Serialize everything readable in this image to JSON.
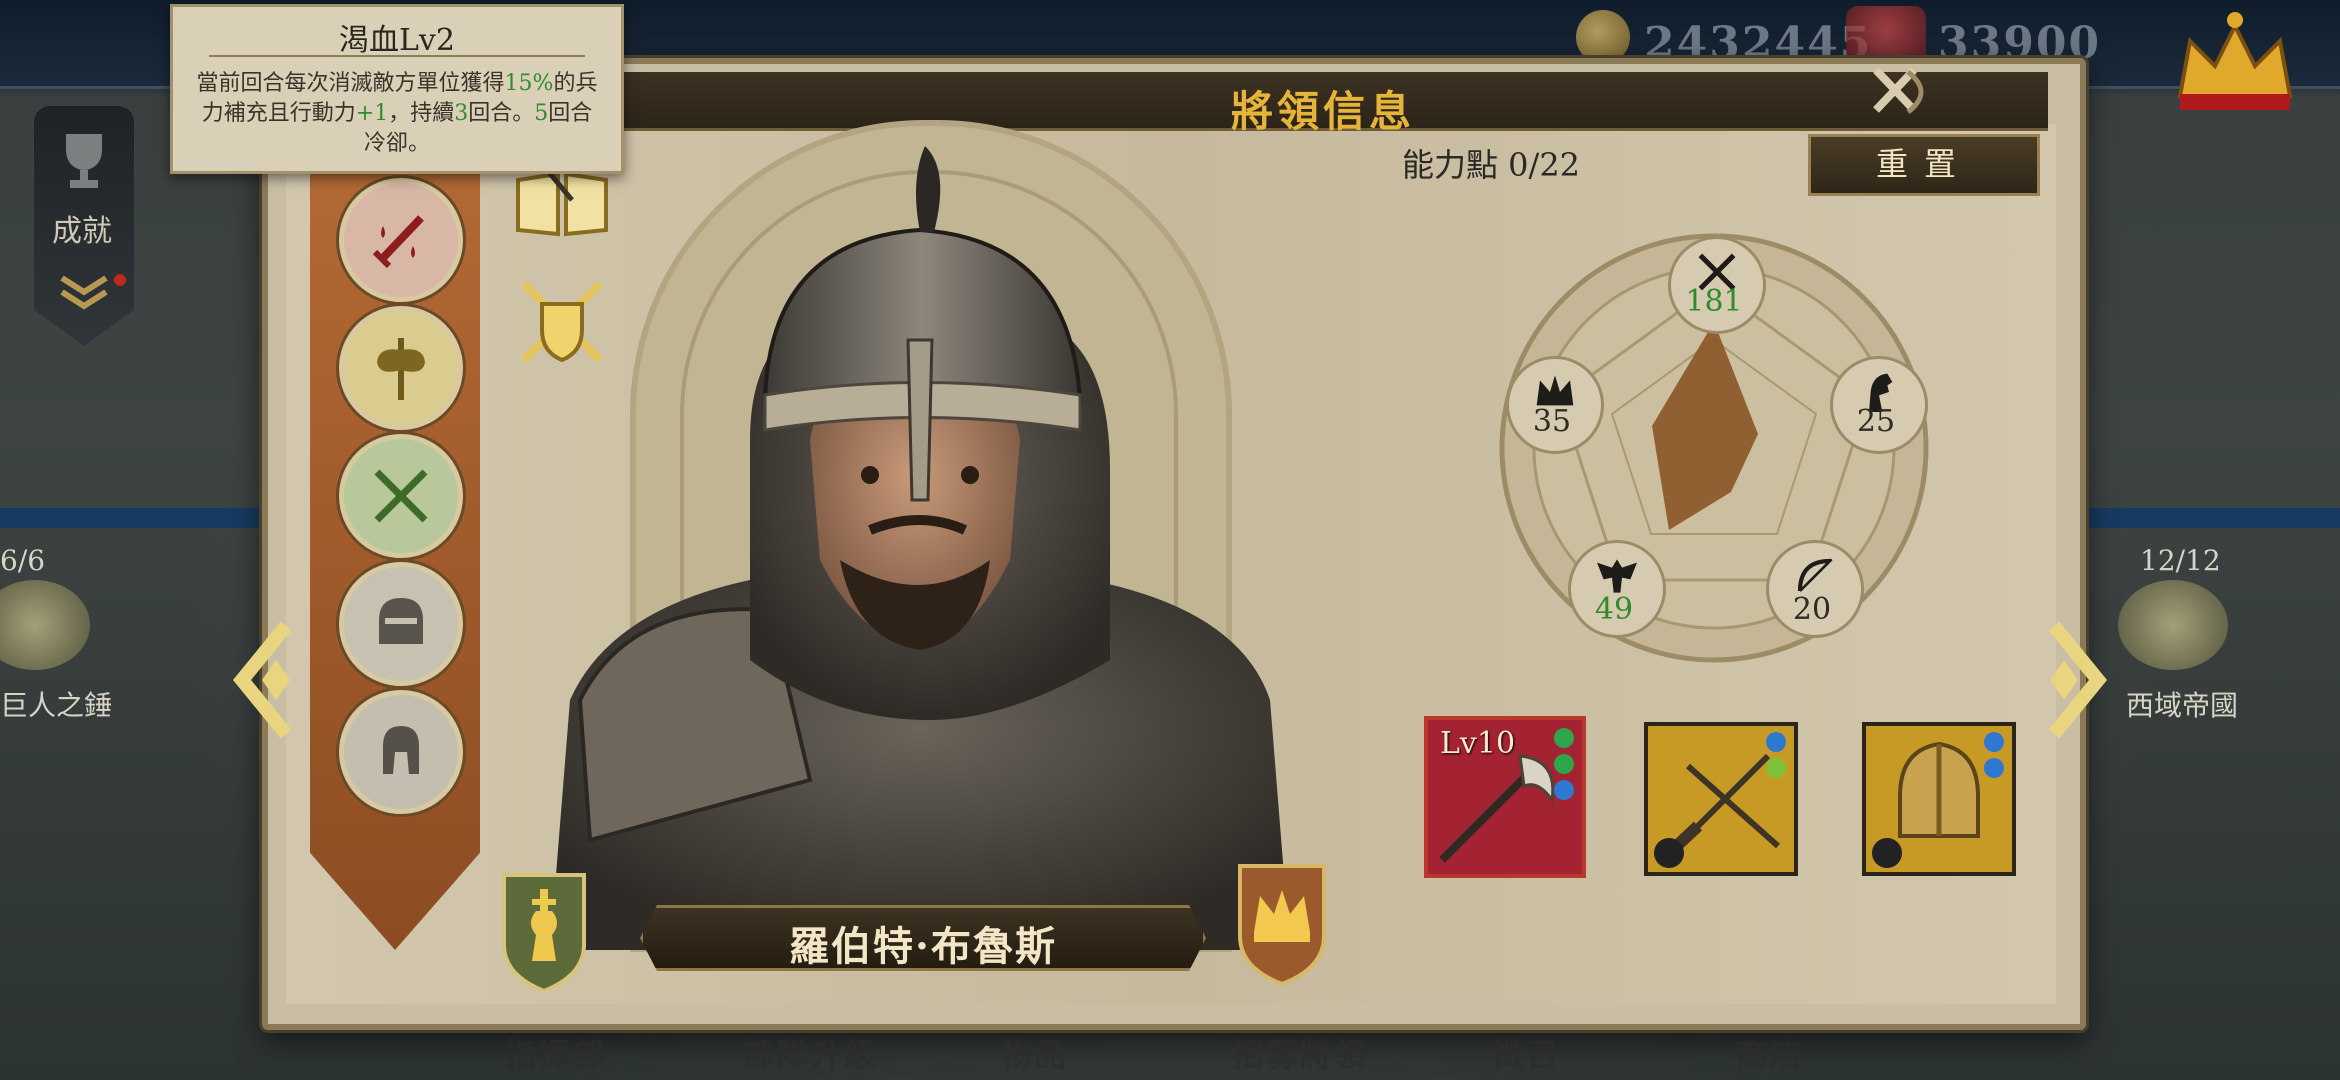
{
  "resources": {
    "coins": "2432445",
    "hats": "33900"
  },
  "achievement_label": "成就",
  "left_side": {
    "count": "6/6",
    "label": "巨人之錘"
  },
  "right_side": {
    "count": "12/12",
    "label": "西域帝國"
  },
  "panel": {
    "title": "將領信息"
  },
  "tooltip": {
    "title": "渴血Lv2",
    "desc_parts": [
      "當前回合每次消滅敵方單位獲得",
      "15%",
      "的兵力補充且行動力",
      "+1",
      "，持續",
      "3",
      "回合。",
      "5",
      "回合冷卻。"
    ]
  },
  "general": {
    "name": "羅伯特·布魯斯"
  },
  "ability": {
    "label": "能力點 0/22",
    "reset_label": "重置"
  },
  "stats": {
    "attack": {
      "icon": "crossed-swords-icon",
      "value": "181",
      "color": "#2e8b2e"
    },
    "cavalry": {
      "icon": "horse-head-icon",
      "value": "25"
    },
    "archery": {
      "icon": "bow-icon",
      "value": "20"
    },
    "infantry": {
      "icon": "eagle-icon",
      "value": "49",
      "color": "#2e8b2e"
    },
    "politics": {
      "icon": "crown-icon",
      "value": "35"
    }
  },
  "equipment": [
    {
      "name": "axe",
      "level": "Lv10"
    },
    {
      "name": "weapon-set"
    },
    {
      "name": "helmet"
    }
  ],
  "nav": [
    "指揮部",
    "部隊升級",
    "物品",
    "招募將領",
    "徵召",
    "商店"
  ],
  "colors": {
    "gold_title": "#e7b43a",
    "panel_bg": "#c9bea4",
    "skill_column": "#a65c2c",
    "highlight_green": "#2e8b2e"
  }
}
